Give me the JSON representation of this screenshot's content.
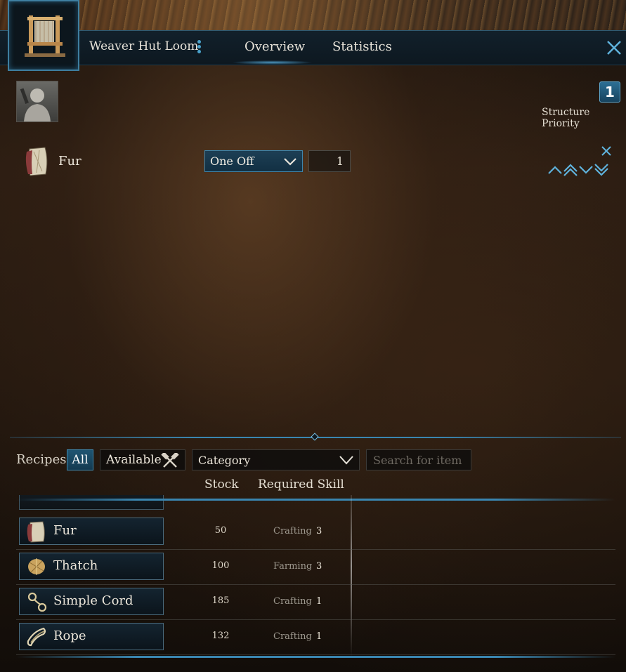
{
  "window": {
    "title": "Weaver Hut Loom",
    "tabs": [
      {
        "label": "Overview"
      },
      {
        "label": "Statistics"
      }
    ]
  },
  "priority": {
    "value": "1",
    "label": "Structure Priority"
  },
  "order": {
    "name": "Fur",
    "mode": "One Off",
    "quantity": "1",
    "icon": "fur-icon"
  },
  "recipes": {
    "label": "Recipes",
    "filter_all": "All",
    "filter_available": "Available",
    "category": "Category",
    "search_placeholder": "Search for item",
    "columns": {
      "stock": "Stock",
      "skill": "Required Skill"
    },
    "items": [
      {
        "name": "Fur",
        "stock": "50",
        "skill": "Crafting",
        "level": "3",
        "icon": "fur-icon"
      },
      {
        "name": "Thatch",
        "stock": "100",
        "skill": "Farming",
        "level": "3",
        "icon": "thatch-icon"
      },
      {
        "name": "Simple Cord",
        "stock": "185",
        "skill": "Crafting",
        "level": "1",
        "icon": "cord-icon"
      },
      {
        "name": "Rope",
        "stock": "132",
        "skill": "Crafting",
        "level": "1",
        "icon": "rope-icon"
      }
    ]
  },
  "colors": {
    "accent": "#3a86b0",
    "panel": "#0d1820",
    "text": "#ece6da"
  }
}
